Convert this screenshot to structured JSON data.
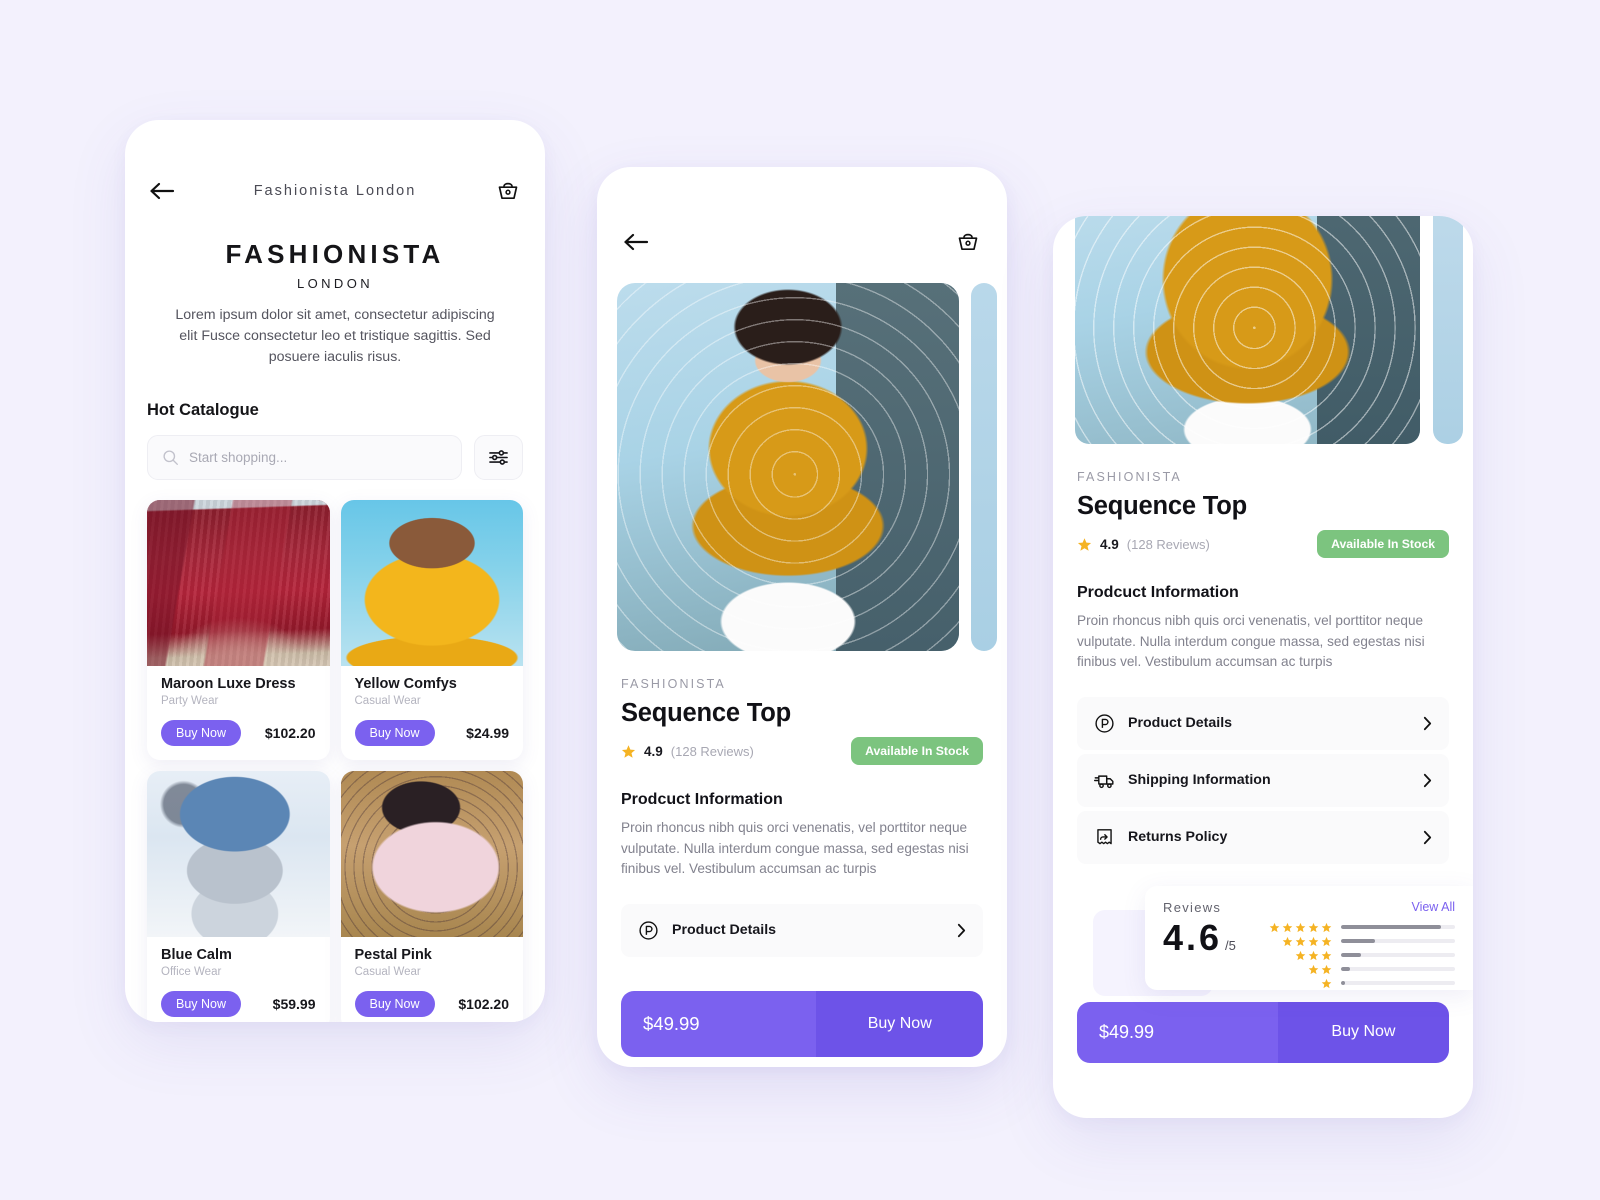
{
  "theme": {
    "background": "#f3f1fd",
    "accent": "#7b61ef",
    "accent_dark": "#6d53e8",
    "stock_green": "#7cc47f",
    "star_yellow": "#f5b323"
  },
  "phone1": {
    "topbar": {
      "back_icon": "arrow-left-icon",
      "title": "Fashionista London",
      "cart_icon": "basket-icon"
    },
    "brand": {
      "name": "FASHIONISTA",
      "city": "LONDON",
      "description": "Lorem ipsum dolor sit amet, consectetur adipiscing elit Fusce consectetur leo et tristique sagittis. Sed posuere iaculis risus."
    },
    "catalogue": {
      "section_title": "Hot Catalogue",
      "search_placeholder": "Start shopping...",
      "search_value": "",
      "search_icon": "search-icon",
      "filter_icon": "sliders-icon"
    },
    "products": [
      {
        "name": "Maroon Luxe Dress",
        "category": "Party Wear",
        "price": "$102.20",
        "buy_label": "Buy Now",
        "art": "img-maroon"
      },
      {
        "name": "Yellow Comfys",
        "category": "Casual Wear",
        "price": "$24.99",
        "buy_label": "Buy Now",
        "art": "img-yellow"
      },
      {
        "name": "Blue Calm",
        "category": "Office Wear",
        "price": "$59.99",
        "buy_label": "Buy Now",
        "art": "img-blue"
      },
      {
        "name": "Pestal Pink",
        "category": "Casual Wear",
        "price": "$102.20",
        "buy_label": "Buy Now",
        "art": "img-pink"
      }
    ]
  },
  "phone2": {
    "topbar": {
      "back_icon": "arrow-left-icon",
      "cart_icon": "basket-icon"
    },
    "product": {
      "brand": "FASHIONISTA",
      "title": "Sequence Top",
      "rating": "4.9",
      "reviews": "(128 Reviews)",
      "stock_badge": "Available In Stock",
      "info_heading": "Prodcuct Information",
      "info_text": "Proin rhoncus nibh quis orci venenatis, vel porttitor neque vulputate. Nulla interdum congue massa, sed egestas nisi finibus vel. Vestibulum accumsan ac turpis"
    },
    "accordions": [
      {
        "label": "Product Details",
        "icon": "circled-p-icon"
      }
    ],
    "cta": {
      "price": "$49.99",
      "buy_label": "Buy Now"
    }
  },
  "phone3": {
    "product": {
      "brand": "FASHIONISTA",
      "title": "Sequence Top",
      "rating": "4.9",
      "reviews": "(128 Reviews)",
      "stock_badge": "Available In Stock",
      "info_heading": "Prodcuct Information",
      "info_text": "Proin rhoncus nibh quis orci venenatis, vel porttitor neque vulputate. Nulla interdum congue massa, sed egestas nisi finibus vel. Vestibulum accumsan ac turpis"
    },
    "accordions": [
      {
        "label": "Product Details",
        "icon": "circled-p-icon"
      },
      {
        "label": "Shipping Information",
        "icon": "delivery-truck-icon"
      },
      {
        "label": "Returns Policy",
        "icon": "return-receipt-icon"
      }
    ],
    "reviews": {
      "title": "Reviews",
      "view_all": "View All",
      "score": "4.6",
      "out_of": "/5",
      "breakdown": [
        {
          "stars": 5,
          "percent": 88
        },
        {
          "stars": 4,
          "percent": 30
        },
        {
          "stars": 3,
          "percent": 18
        },
        {
          "stars": 2,
          "percent": 8
        },
        {
          "stars": 1,
          "percent": 4
        }
      ]
    },
    "cta": {
      "price": "$49.99",
      "buy_label": "Buy Now"
    }
  }
}
